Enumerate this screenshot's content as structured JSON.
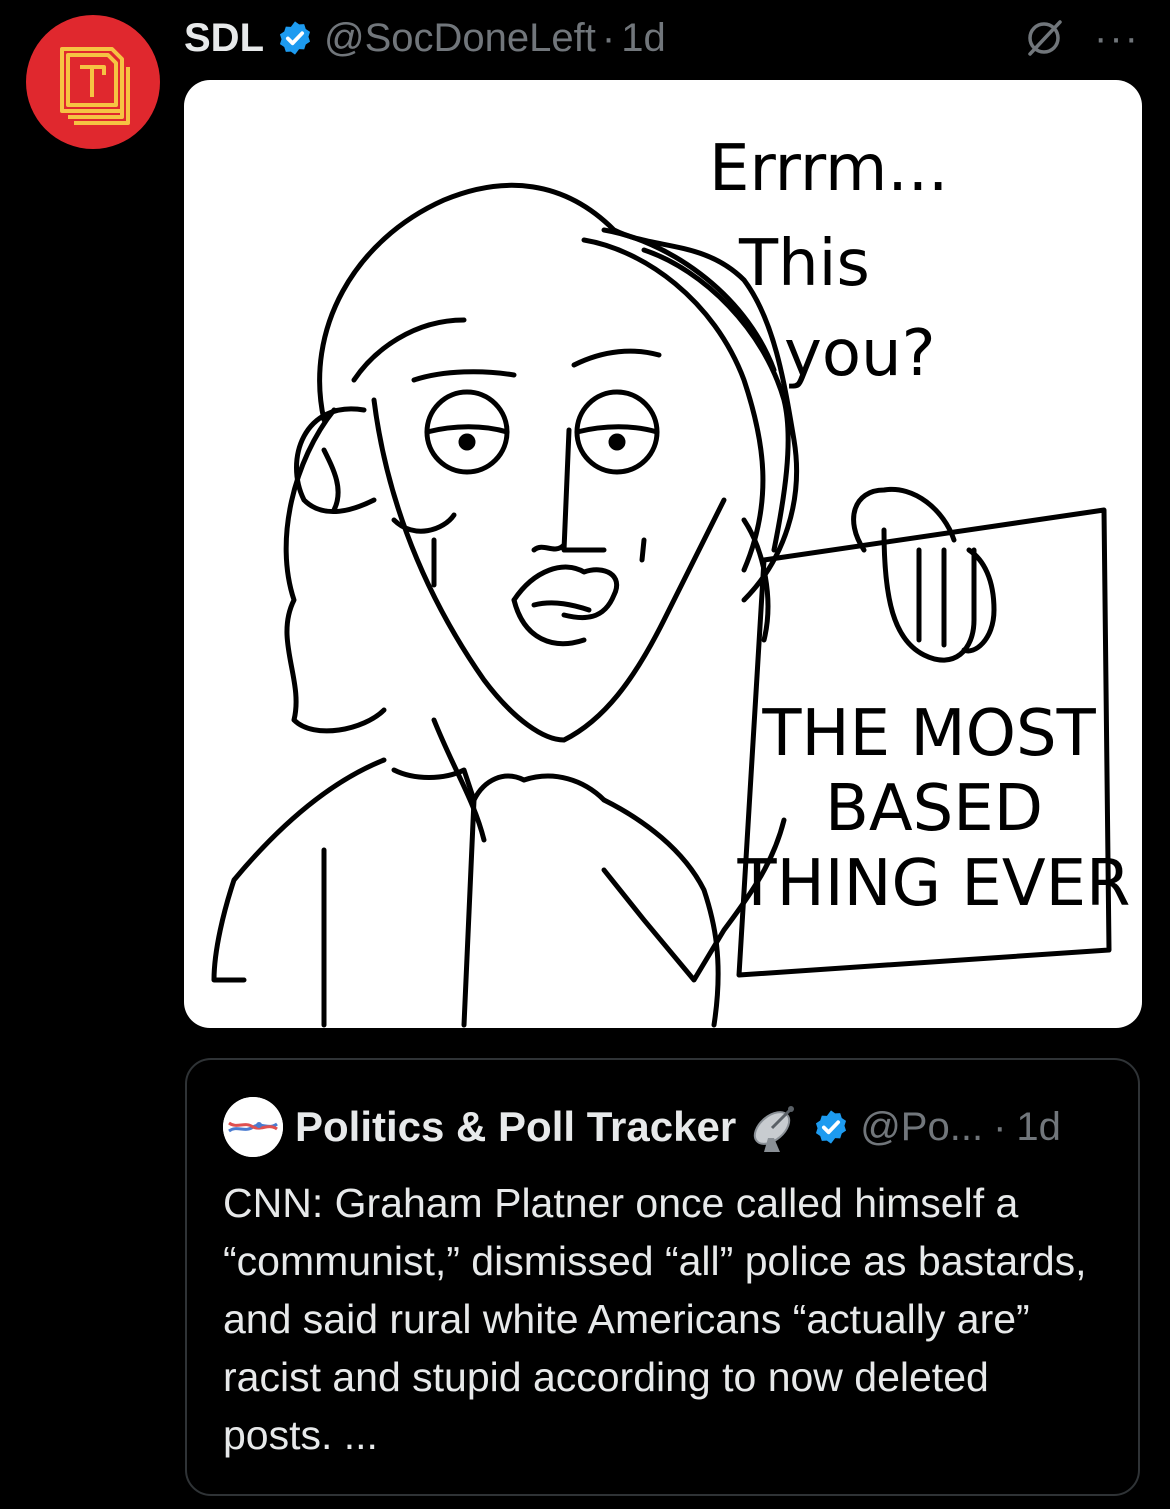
{
  "tweet": {
    "author_name": "SDL",
    "handle": "@SocDoneLeft",
    "separator": "·",
    "time": "1d",
    "more_label": "···",
    "comic": {
      "speech": [
        "Errrm...",
        "This",
        "you?"
      ],
      "sign": [
        "THE MOST",
        "BASED",
        "THING EVER"
      ]
    }
  },
  "quote": {
    "author_name": "Politics & Poll Tracker",
    "handle": "@Po...",
    "separator": "·",
    "time": "1d",
    "text": "CNN: Graham Platner once called himself a “communist,” dismissed “all” police as bastards, and said rural white Americans “actually are” racist and stupid according to now deleted posts. ..."
  },
  "colors": {
    "background": "#000000",
    "avatar_red": "#e0282e",
    "avatar_gold": "#f6c343",
    "verified_blue": "#1d9bf0",
    "secondary_text": "#71767b"
  },
  "icons": [
    "t-logo-icon",
    "verified-badge-icon",
    "grok-icon",
    "more-icon",
    "satellite-dish-icon"
  ]
}
